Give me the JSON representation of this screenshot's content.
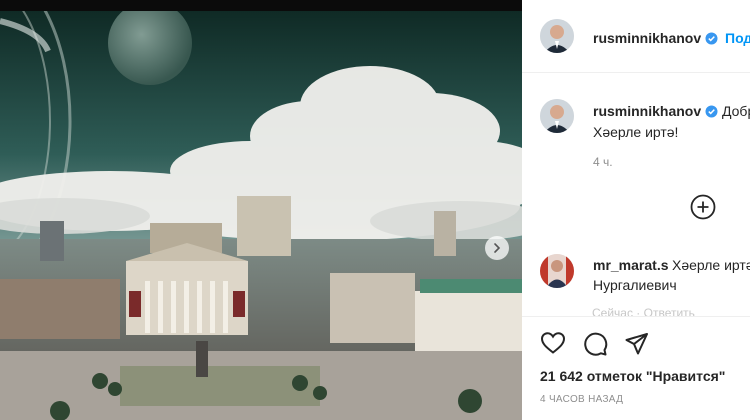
{
  "post_header": {
    "username": "rusminnikhanov",
    "follow_label": "Подписаться"
  },
  "caption": {
    "username": "rusminnikhanov",
    "text_line1": "Доброе утро!",
    "text_line2": "Хәерле иртә!",
    "time": "4 ч."
  },
  "comment": {
    "username": "mr_marat.s",
    "text_line1": "Хәерле иртә",
    "text_line2": "Нургалиевич",
    "meta_partial": "Сейчас · Ответить"
  },
  "likes_text": "21 642 отметок \"Нравится\"",
  "time_ago": "4 ЧАСОВ НАЗАД",
  "colors": {
    "link_blue": "#0095f6",
    "verified_blue": "#3897f0",
    "text": "#262626",
    "muted": "#8e8e8e"
  },
  "icons": [
    "verified-badge-icon",
    "plus-circle-icon",
    "heart-icon",
    "comment-icon",
    "share-icon",
    "chevron-right-icon"
  ]
}
